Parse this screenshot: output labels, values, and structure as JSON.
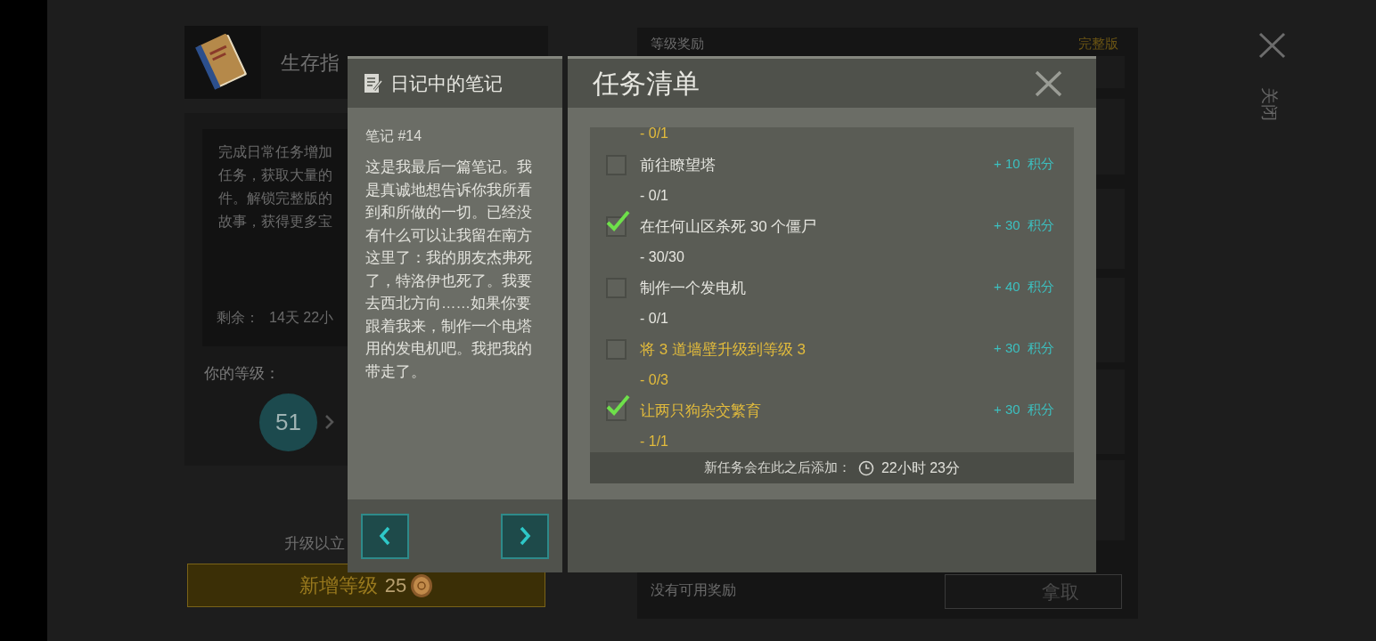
{
  "background": {
    "guide_title": "生存指",
    "description_lines": [
      "完成日常任务增加",
      "任务，获取大量的",
      "件。解锁完整版的",
      "故事，获得更多宝"
    ],
    "remaining_label": "剩余：",
    "remaining_value": "14天 22小",
    "level_label": "你的等级：",
    "level": "51",
    "upgrade_hint": "升级以立",
    "upgrade_button": {
      "label": "新增等级",
      "price": "25"
    },
    "rewards_title": "等级奖励",
    "full_version": "完整版",
    "no_rewards": "没有可用奖励",
    "claim_button": "拿取",
    "close_label": "关闭"
  },
  "note_panel": {
    "title": "日记中的笔记",
    "note_number": "笔记 #14",
    "text": "这是我最后一篇笔记。我是真诚地想告诉你我所看到和所做的一切。已经没有什么可以让我留在南方这里了：我的朋友杰弗死了，特洛伊也死了。我要去西北方向……如果你要跟着我来，制作一个电塔用的发电机吧。我把我的带走了。"
  },
  "task_panel": {
    "title": "任务清单",
    "partial_progress": {
      "text": "- 0/1",
      "highlighted": true
    },
    "tasks": [
      {
        "title": "前往瞭望塔",
        "progress": "- 0/1",
        "points": "+ 10  积分",
        "checked": false,
        "highlighted": false
      },
      {
        "title": "在任何山区杀死 30 个僵尸",
        "progress": "- 30/30",
        "points": "+ 30  积分",
        "checked": true,
        "highlighted": false
      },
      {
        "title": "制作一个发电机",
        "progress": "- 0/1",
        "points": "+ 40  积分",
        "checked": false,
        "highlighted": false
      },
      {
        "title": "将 3 道墙壁升级到等级 3",
        "progress": "- 0/3",
        "points": "+ 30  积分",
        "checked": false,
        "highlighted": true
      },
      {
        "title": "让两只狗杂交繁育",
        "progress": "- 1/1",
        "points": "+ 30  积分",
        "checked": true,
        "highlighted": true
      }
    ],
    "footer_label": "新任务会在此之后添加：",
    "footer_time": "22小时 23分"
  }
}
